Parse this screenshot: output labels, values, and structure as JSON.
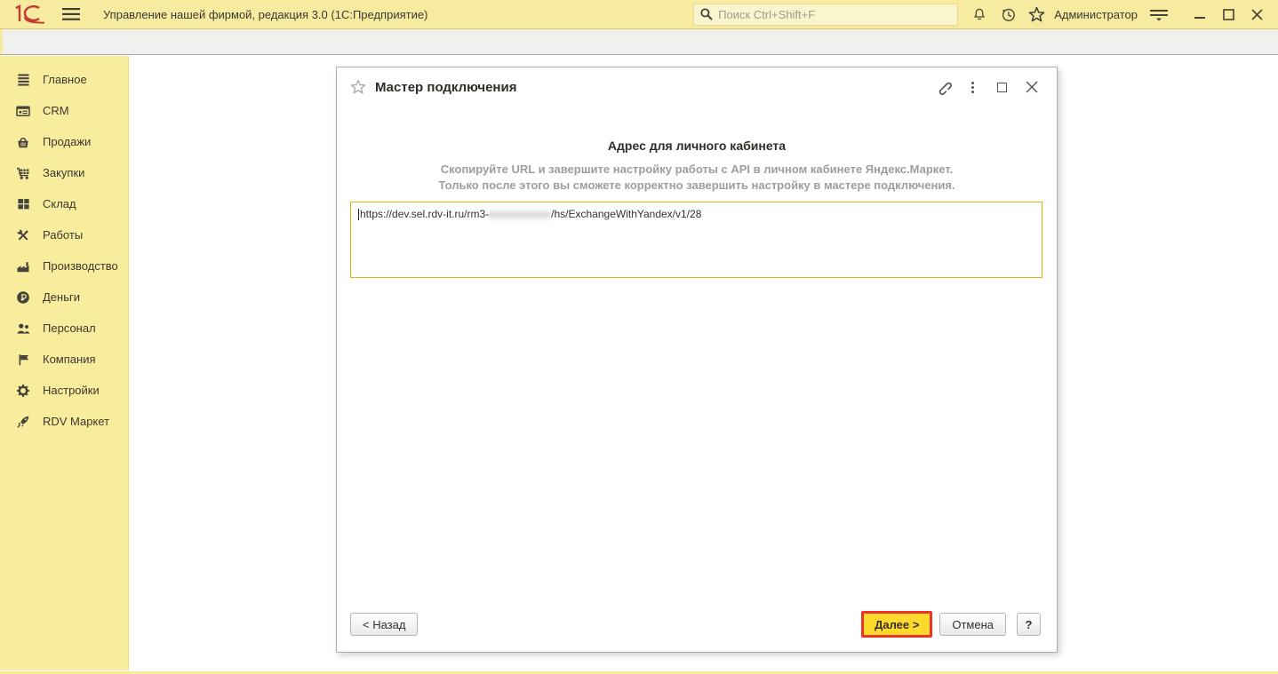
{
  "topbar": {
    "logo_text": "1С",
    "app_title": "Управление нашей фирмой, редакция 3.0  (1С:Предприятие)",
    "search_placeholder": "Поиск Ctrl+Shift+F",
    "user_name": "Администратор"
  },
  "sidebar": {
    "items": [
      {
        "label": "Главное",
        "icon": "menu-icon"
      },
      {
        "label": "CRM",
        "icon": "crm-card-icon"
      },
      {
        "label": "Продажи",
        "icon": "basket-icon"
      },
      {
        "label": "Закупки",
        "icon": "cart-icon"
      },
      {
        "label": "Склад",
        "icon": "warehouse-icon"
      },
      {
        "label": "Работы",
        "icon": "tools-icon"
      },
      {
        "label": "Производство",
        "icon": "factory-icon"
      },
      {
        "label": "Деньги",
        "icon": "ruble-coin-icon"
      },
      {
        "label": "Персонал",
        "icon": "people-icon"
      },
      {
        "label": "Компания",
        "icon": "flag-icon"
      },
      {
        "label": "Настройки",
        "icon": "gear-icon"
      },
      {
        "label": "RDV Маркет",
        "icon": "rocket-icon"
      }
    ]
  },
  "dialog": {
    "title": "Мастер подключения",
    "heading": "Адрес для личного кабинета",
    "description_line1": "Скопируйте URL и завершите настройку работы с API в личном кабинете Яндекс.Маркет.",
    "description_line2": "Только после этого вы сможете корректно завершить настройку в мастере подключения.",
    "url_field": {
      "prefix": "https://dev.sel.rdv-it.ru/rm3-",
      "redacted": "xxxxxxxxxx",
      "suffix": "/hs/ExchangeWithYandex/v1/28"
    },
    "buttons": {
      "back": "< Назад",
      "next": "Далее >",
      "cancel": "Отмена",
      "help": "?"
    }
  },
  "colors": {
    "titlebar_yellow": "#F6EB9E",
    "sidebar_yellow": "#F8EC9D",
    "url_border_gold": "#E0B400",
    "next_button_yellow": "#FFD92B",
    "annotation_red": "#ED3226"
  }
}
